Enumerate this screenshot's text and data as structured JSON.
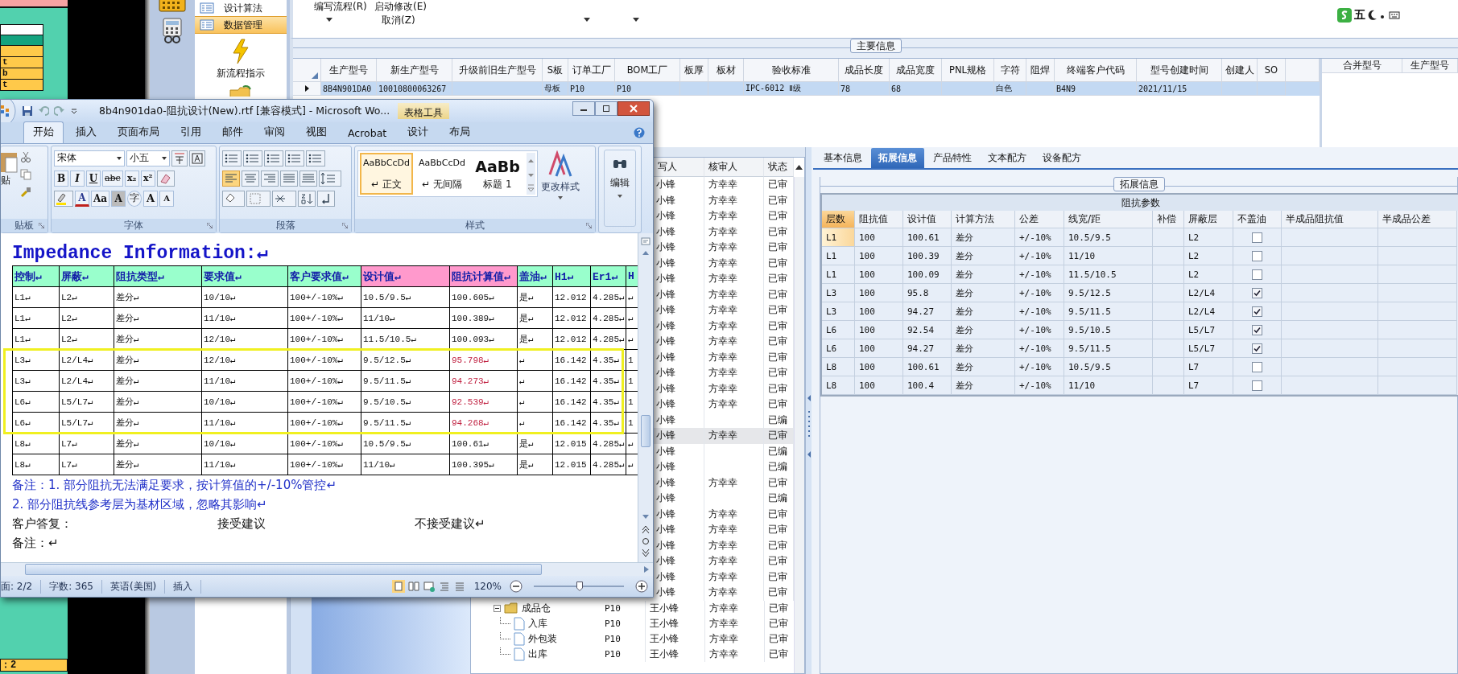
{
  "left_strip": {
    "rows": [
      "t",
      "b",
      "t"
    ],
    "footer": "：2"
  },
  "nav": {
    "items": [
      {
        "label": "设计算法",
        "selected": false
      },
      {
        "label": "数据管理",
        "selected": true
      }
    ],
    "launcher": "新流程指示"
  },
  "toolbar": {
    "commands": [
      "编写流程(R)",
      "启动修改(E)",
      "取消(Z)"
    ]
  },
  "ime": {
    "label": "五"
  },
  "main_info": {
    "title": "主要信息",
    "columns": [
      "生产型号",
      "新生产型号",
      "升级前旧生产型号",
      "S板",
      "订单工厂",
      "BOM工厂",
      "板厚",
      "板材",
      "验收标准",
      "成品长度",
      "成品宽度",
      "PNL规格",
      "字符",
      "阻焊",
      "终端客户代码",
      "型号创建时间",
      "创建人",
      "SO"
    ],
    "rows": [
      {
        "selected": true,
        "cells": [
          "8B4N901DA0",
          "10010800063267",
          null,
          "母板",
          "P10",
          "P10",
          null,
          null,
          "IPC-6012 Ⅱ级",
          "78",
          "68",
          null,
          "白色",
          null,
          "B4N9",
          "2021/11/15",
          null,
          null
        ]
      }
    ],
    "side_columns": [
      "合并型号",
      "生产型号"
    ]
  },
  "list": {
    "columns": [
      "写人",
      "核审人",
      "状态"
    ],
    "rows": [
      {
        "writer": "小锋",
        "reviewer": "方幸幸",
        "status": "已审",
        "selected": false
      },
      {
        "writer": "小锋",
        "reviewer": "方幸幸",
        "status": "已审",
        "selected": false
      },
      {
        "writer": "小锋",
        "reviewer": "方幸幸",
        "status": "已审",
        "selected": false
      },
      {
        "writer": "小锋",
        "reviewer": "方幸幸",
        "status": "已审",
        "selected": false
      },
      {
        "writer": "小锋",
        "reviewer": "方幸幸",
        "status": "已审",
        "selected": false
      },
      {
        "writer": "小锋",
        "reviewer": "方幸幸",
        "status": "已审",
        "selected": false
      },
      {
        "writer": "小锋",
        "reviewer": "方幸幸",
        "status": "已审",
        "selected": false
      },
      {
        "writer": "小锋",
        "reviewer": "方幸幸",
        "status": "已审",
        "selected": false
      },
      {
        "writer": "小锋",
        "reviewer": "方幸幸",
        "status": "已审",
        "selected": false
      },
      {
        "writer": "小锋",
        "reviewer": "方幸幸",
        "status": "已审",
        "selected": false
      },
      {
        "writer": "小锋",
        "reviewer": "方幸幸",
        "status": "已审",
        "selected": false
      },
      {
        "writer": "小锋",
        "reviewer": "方幸幸",
        "status": "已审",
        "selected": false
      },
      {
        "writer": "小锋",
        "reviewer": "方幸幸",
        "status": "已审",
        "selected": false
      },
      {
        "writer": "小锋",
        "reviewer": "方幸幸",
        "status": "已审",
        "selected": false
      },
      {
        "writer": "小锋",
        "reviewer": "方幸幸",
        "status": "已审",
        "selected": false
      },
      {
        "writer": "小锋",
        "status": "已编",
        "selected": false
      },
      {
        "writer": "小锋",
        "reviewer": "方幸幸",
        "status": "已审",
        "selected": true
      },
      {
        "writer": "小锋",
        "status": "已编",
        "selected": false
      },
      {
        "writer": "小锋",
        "status": "已编",
        "selected": false
      },
      {
        "writer": "小锋",
        "reviewer": "方幸幸",
        "status": "已审",
        "selected": false
      },
      {
        "writer": "小锋",
        "status": "已编",
        "selected": false
      },
      {
        "writer": "小锋",
        "reviewer": "方幸幸",
        "status": "已审",
        "selected": false
      },
      {
        "writer": "小锋",
        "reviewer": "方幸幸",
        "status": "已审",
        "selected": false
      },
      {
        "writer": "小锋",
        "reviewer": "方幸幸",
        "status": "已审",
        "selected": false
      },
      {
        "writer": "小锋",
        "reviewer": "方幸幸",
        "status": "已审",
        "selected": false
      },
      {
        "writer": "小锋",
        "reviewer": "方幸幸",
        "status": "已审",
        "selected": false
      },
      {
        "writer": "小锋",
        "reviewer": "方幸幸",
        "status": "已审",
        "selected": false
      }
    ],
    "tree": [
      {
        "label": "成品仓",
        "factory": "P10",
        "writer": "王小锋",
        "reviewer": "方幸幸",
        "status": "已审",
        "expanded": true,
        "children": [
          {
            "label": "入库",
            "factory": "P10",
            "writer": "王小锋",
            "reviewer": "方幸幸",
            "status": "已审"
          },
          {
            "label": "外包装",
            "factory": "P10",
            "writer": "王小锋",
            "reviewer": "方幸幸",
            "status": "已审"
          },
          {
            "label": "出库",
            "factory": "P10",
            "writer": "王小锋",
            "reviewer": "方幸幸",
            "status": "已审"
          }
        ]
      }
    ]
  },
  "right": {
    "tabs": [
      {
        "label": "基本信息",
        "selected": false
      },
      {
        "label": "拓展信息",
        "selected": true
      },
      {
        "label": "产品特性",
        "selected": false
      },
      {
        "label": "文本配方",
        "selected": false
      },
      {
        "label": "设备配方",
        "selected": false
      }
    ],
    "group_title": "拓展信息",
    "table": {
      "title": "阻抗参数",
      "columns": [
        "层数",
        "阻抗值",
        "设计值",
        "计算方法",
        "公差",
        "线宽/距",
        "补偿",
        "屏蔽层",
        "不盖油",
        "半成品阻抗值",
        "半成品公差"
      ],
      "rows": [
        {
          "layer": "L1",
          "impedance": "100",
          "design": "100.61",
          "method": "差分",
          "tolerance": "+/-10%",
          "width": "10.5/9.5",
          "shield": "L2",
          "no_oil": false,
          "active": true
        },
        {
          "layer": "L1",
          "impedance": "100",
          "design": "100.39",
          "method": "差分",
          "tolerance": "+/-10%",
          "width": "11/10",
          "shield": "L2",
          "no_oil": false,
          "active": false
        },
        {
          "layer": "L1",
          "impedance": "100",
          "design": "100.09",
          "method": "差分",
          "tolerance": "+/-10%",
          "width": "11.5/10.5",
          "shield": "L2",
          "no_oil": false,
          "active": false
        },
        {
          "layer": "L3",
          "impedance": "100",
          "design": "95.8",
          "method": "差分",
          "tolerance": "+/-10%",
          "width": "9.5/12.5",
          "shield": "L2/L4",
          "no_oil": true,
          "active": false
        },
        {
          "layer": "L3",
          "impedance": "100",
          "design": "94.27",
          "method": "差分",
          "tolerance": "+/-10%",
          "width": "9.5/11.5",
          "shield": "L2/L4",
          "no_oil": true,
          "active": false
        },
        {
          "layer": "L6",
          "impedance": "100",
          "design": "92.54",
          "method": "差分",
          "tolerance": "+/-10%",
          "width": "9.5/10.5",
          "shield": "L5/L7",
          "no_oil": true,
          "active": false
        },
        {
          "layer": "L6",
          "impedance": "100",
          "design": "94.27",
          "method": "差分",
          "tolerance": "+/-10%",
          "width": "9.5/11.5",
          "shield": "L5/L7",
          "no_oil": true,
          "active": false
        },
        {
          "layer": "L8",
          "impedance": "100",
          "design": "100.61",
          "method": "差分",
          "tolerance": "+/-10%",
          "width": "10.5/9.5",
          "shield": "L7",
          "no_oil": false,
          "active": false
        },
        {
          "layer": "L8",
          "impedance": "100",
          "design": "100.4",
          "method": "差分",
          "tolerance": "+/-10%",
          "width": "11/10",
          "shield": "L7",
          "no_oil": false,
          "active": false
        }
      ]
    }
  },
  "word": {
    "title": "8b4n901da0-阻抗设计(New).rtf [兼容模式] - Microsoft Wo...",
    "context_tab": "表格工具",
    "tabs": [
      {
        "label": "开始",
        "selected": true
      },
      {
        "label": "插入",
        "selected": false
      },
      {
        "label": "页面布局",
        "selected": false
      },
      {
        "label": "引用",
        "selected": false
      },
      {
        "label": "邮件",
        "selected": false
      },
      {
        "label": "审阅",
        "selected": false
      },
      {
        "label": "视图",
        "selected": false
      },
      {
        "label": "Acrobat",
        "selected": false
      },
      {
        "label": "设计",
        "selected": false
      },
      {
        "label": "布局",
        "selected": false
      }
    ],
    "clipboard": {
      "paste": "贴",
      "label": "贴板"
    },
    "font": {
      "name": "宋体",
      "size": "小五",
      "format_buttons": [
        "B",
        "I",
        "U",
        "abc",
        "x₂",
        "x²"
      ],
      "effect_buttons": [
        {
          "label": "A",
          "kind": "color"
        },
        {
          "label": "Aa",
          "kind": "case"
        },
        {
          "label": "A",
          "kind": "shade"
        },
        {
          "label": "字",
          "kind": "circle"
        },
        {
          "label": "A",
          "kind": "grow"
        },
        {
          "label": "A",
          "kind": "shrink"
        }
      ],
      "label": "字体"
    },
    "paragraph": {
      "label": "段落",
      "alignments": [
        {
          "kind": "left",
          "selected": true
        },
        {
          "kind": "center",
          "selected": false
        },
        {
          "kind": "right",
          "selected": false
        },
        {
          "kind": "justify",
          "selected": false
        },
        {
          "kind": "distributed",
          "selected": false
        }
      ]
    },
    "styles": {
      "items": [
        {
          "preview": "AaBbCcDd",
          "label": "↵ 正文",
          "selected": true
        },
        {
          "preview": "AaBbCcDd",
          "label": "↵ 无间隔",
          "selected": false
        },
        {
          "preview": "AaBb",
          "label": "标题 1",
          "selected": false
        }
      ],
      "change": "更改样式",
      "label": "样式"
    },
    "editing": {
      "label": "编辑"
    },
    "document": {
      "heading": "Impedance Information:↵",
      "columns": [
        {
          "label": "控制↵",
          "color": "#99ffcc"
        },
        {
          "label": "屏蔽↵",
          "color": "#99ffcc"
        },
        {
          "label": "阻抗类型↵",
          "color": "#99ffcc"
        },
        {
          "label": "要求值↵",
          "color": "#99ffcc"
        },
        {
          "label": "客户要求值↵",
          "color": "#99ffcc"
        },
        {
          "label": "设计值↵",
          "color": "#ff99cc"
        },
        {
          "label": "阻抗计算值↵",
          "color": "#ff99cc"
        },
        {
          "label": "盖油↵",
          "color": "#99ffcc"
        },
        {
          "label": "H1↵",
          "color": "#99ffcc"
        },
        {
          "label": "Er1↵",
          "color": "#99ffcc"
        },
        {
          "label": "H",
          "color": "#99ffcc"
        }
      ],
      "rows": [
        {
          "boxed": false,
          "flagged": false,
          "cells": [
            "L1↵",
            "L2↵",
            "差分↵",
            "10/10↵",
            "100+/-10%↵",
            "10.5/9.5↵",
            "100.605↵",
            "是↵",
            "12.012",
            "4.285↵",
            "↵"
          ]
        },
        {
          "boxed": false,
          "flagged": false,
          "cells": [
            "L1↵",
            "L2↵",
            "差分↵",
            "11/10↵",
            "100+/-10%↵",
            "11/10↵",
            "100.389↵",
            "是↵",
            "12.012",
            "4.285↵",
            "↵"
          ]
        },
        {
          "boxed": false,
          "flagged": false,
          "cells": [
            "L1↵",
            "L2↵",
            "差分↵",
            "12/10↵",
            "100+/-10%↵",
            "11.5/10.5↵",
            "100.093↵",
            "是↵",
            "12.012",
            "4.285↵",
            "↵"
          ]
        },
        {
          "boxed": true,
          "flagged": true,
          "cells": [
            "L3↵",
            "L2/L4↵",
            "差分↵",
            "12/10↵",
            "100+/-10%↵",
            "9.5/12.5↵",
            "95.798↵",
            "↵",
            "16.142",
            "4.35↵",
            "1"
          ]
        },
        {
          "boxed": true,
          "flagged": true,
          "cells": [
            "L3↵",
            "L2/L4↵",
            "差分↵",
            "11/10↵",
            "100+/-10%↵",
            "9.5/11.5↵",
            "94.273↵",
            "↵",
            "16.142",
            "4.35↵",
            "1"
          ]
        },
        {
          "boxed": true,
          "flagged": true,
          "cells": [
            "L6↵",
            "L5/L7↵",
            "差分↵",
            "10/10↵",
            "100+/-10%↵",
            "9.5/10.5↵",
            "92.539↵",
            "↵",
            "16.142",
            "4.35↵",
            "1"
          ]
        },
        {
          "boxed": true,
          "flagged": true,
          "cells": [
            "L6↵",
            "L5/L7↵",
            "差分↵",
            "11/10↵",
            "100+/-10%↵",
            "9.5/11.5↵",
            "94.268↵",
            "↵",
            "16.142",
            "4.35↵",
            "1"
          ]
        },
        {
          "boxed": false,
          "flagged": false,
          "cells": [
            "L8↵",
            "L7↵",
            "差分↵",
            "10/10↵",
            "100+/-10%↵",
            "10.5/9.5↵",
            "100.61↵",
            "是↵",
            "12.015",
            "4.285↵",
            "↵"
          ]
        },
        {
          "boxed": false,
          "flagged": false,
          "cells": [
            "L8↵",
            "L7↵",
            "差分↵",
            "11/10↵",
            "100+/-10%↵",
            "11/10↵",
            "100.395↵",
            "是↵",
            "12.015",
            "4.285↵",
            "↵"
          ]
        }
      ],
      "notes": [
        "备注：1. 部分阻抗无法满足要求，按计算值的+/-10%管控↵",
        "2. 部分阻抗线参考层为基材区域，忽略其影响↵"
      ],
      "reply": [
        "客户答复：",
        "接受建议",
        "不接受建议↵"
      ],
      "remark": "备注：↵"
    },
    "status": {
      "page": "面: 2/2",
      "words": "字数: 365",
      "language": "英语(美国)",
      "mode": "插入",
      "zoom": "120%",
      "zoom_slider": {
        "level": 0.51
      }
    }
  }
}
